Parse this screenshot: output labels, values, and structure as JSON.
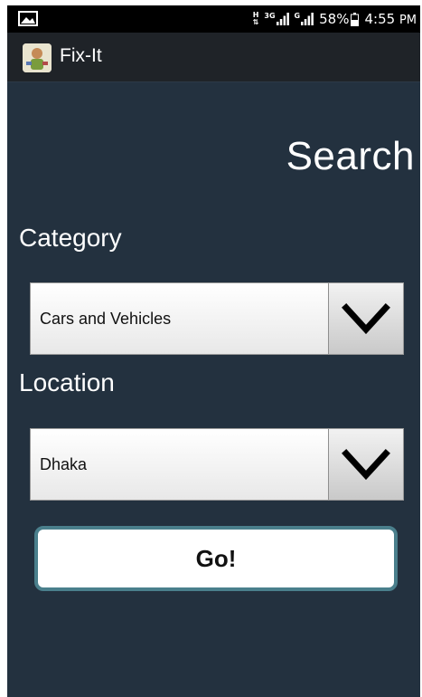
{
  "status_bar": {
    "network_h": "H",
    "network_3g": "3G",
    "network_g": "G",
    "battery": "58%",
    "time": "4:55",
    "ampm": "PM"
  },
  "action_bar": {
    "title": "Fix-It",
    "logo_icon": "app-logo-icon"
  },
  "page": {
    "heading": "Search"
  },
  "category": {
    "label": "Category",
    "selected": "Cars and Vehicles"
  },
  "location": {
    "label": "Location",
    "selected": "Dhaka"
  },
  "go_button": {
    "label": "Go!"
  },
  "colors": {
    "background": "#23313f",
    "status_bar": "#000000",
    "action_bar": "#1f2328",
    "button_border": "#4a7f8c"
  }
}
